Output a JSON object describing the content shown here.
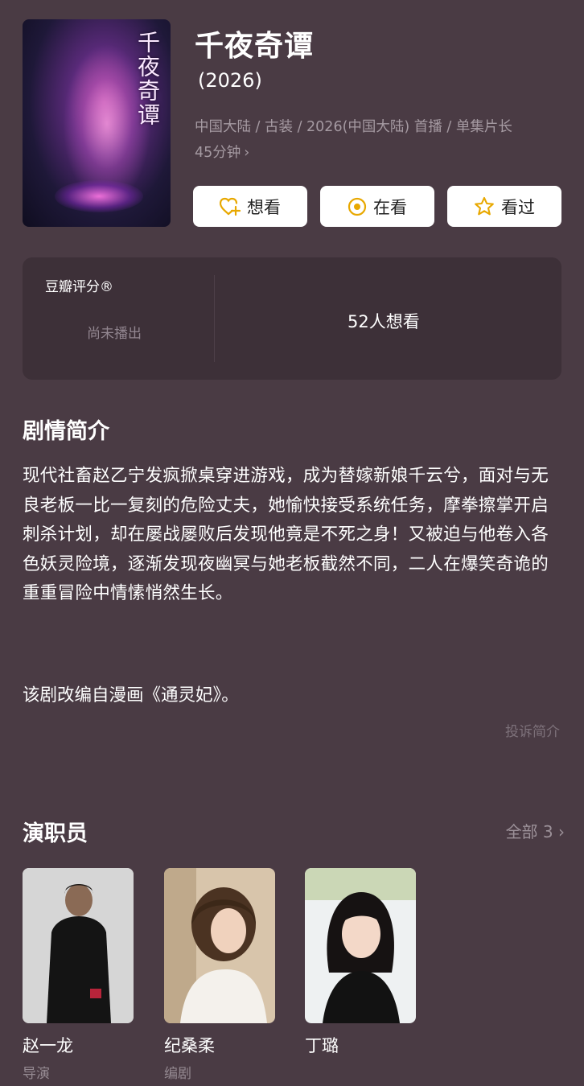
{
  "header": {
    "poster_text": "千夜奇谭",
    "title": "千夜奇谭",
    "year": "(2026)",
    "meta_line": "中国大陆 / 古装 / 2026(中国大陆) 首播 / 单集片长",
    "meta_line2": "45分钟",
    "chevron": "›"
  },
  "actions": [
    {
      "label": "想看",
      "icon": "heart-plus-icon"
    },
    {
      "label": "在看",
      "icon": "target-icon"
    },
    {
      "label": "看过",
      "icon": "star-icon"
    }
  ],
  "rating": {
    "label": "豆瓣评分®",
    "status": "尚未播出",
    "want_count": "52人想看"
  },
  "synopsis": {
    "title": "剧情简介",
    "body": "现代社畜赵乙宁发疯掀桌穿进游戏，成为替嫁新娘千云兮，面对与无良老板一比一复刻的危险丈夫，她愉快接受系统任务，摩拳擦掌开启刺杀计划，却在屡战屡败后发现他竟是不死之身！又被迫与他卷入各色妖灵险境，逐渐发现夜幽冥与她老板截然不同，二人在爆笑奇诡的重重冒险中情愫悄然生长。",
    "note": "该剧改编自漫画《通灵妃》。",
    "report": "投诉简介"
  },
  "cast": {
    "title": "演职员",
    "all_label": "全部 3 ›",
    "members": [
      {
        "name": "赵一龙",
        "role": "导演"
      },
      {
        "name": "纪桑柔",
        "role": "编剧"
      },
      {
        "name": "丁璐",
        "role": ""
      }
    ]
  },
  "colors": {
    "background": "#4a3b44",
    "card": "#3d3038",
    "accent": "#f0b400"
  }
}
